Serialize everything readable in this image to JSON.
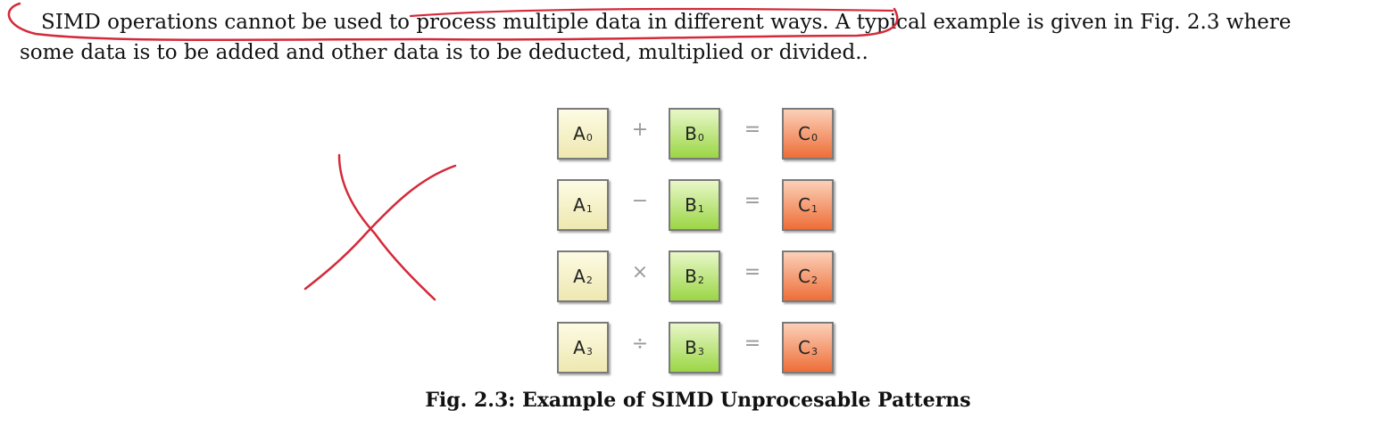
{
  "paragraph": {
    "line1": "SIMD operations cannot be used to process multiple data in different ways. A typical example is given in Fig. 2.3 where",
    "line2": "some data is to be added and other data is to be deducted, multiplied or divided.."
  },
  "figure": {
    "rows": [
      {
        "a_letter": "A",
        "a_sub": "0",
        "op": "+",
        "b_letter": "B",
        "b_sub": "0",
        "eq": "=",
        "c_letter": "C",
        "c_sub": "0"
      },
      {
        "a_letter": "A",
        "a_sub": "1",
        "op": "−",
        "b_letter": "B",
        "b_sub": "1",
        "eq": "=",
        "c_letter": "C",
        "c_sub": "1"
      },
      {
        "a_letter": "A",
        "a_sub": "2",
        "op": "×",
        "b_letter": "B",
        "b_sub": "2",
        "eq": "=",
        "c_letter": "C",
        "c_sub": "2"
      },
      {
        "a_letter": "A",
        "a_sub": "3",
        "op": "÷",
        "b_letter": "B",
        "b_sub": "3",
        "eq": "=",
        "c_letter": "C",
        "c_sub": "3"
      }
    ],
    "caption": "Fig. 2.3: Example of SIMD Unprocesable Patterns"
  },
  "annotations": {
    "ink_color": "#d42a3a",
    "marks": [
      "circle-around-sentence",
      "cross-mark"
    ]
  }
}
